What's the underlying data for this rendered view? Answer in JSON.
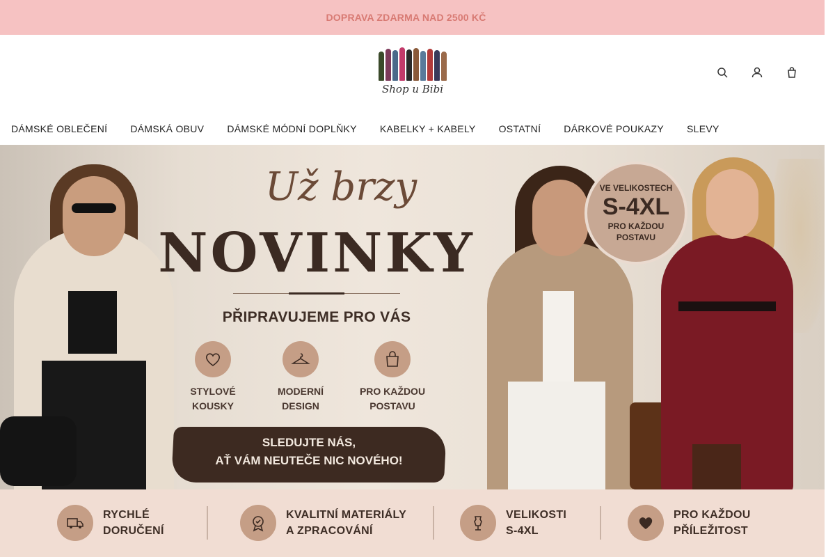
{
  "promo": {
    "text": "DOPRAVA ZDARMA NAD 2500 KČ",
    "glyph1": "",
    "glyph2": ""
  },
  "header": {
    "logo_text": "Shop u Bibi",
    "icons": [
      {
        "name": "search-icon",
        "glyph_a": "",
        "glyph_b": ""
      },
      {
        "name": "user-icon",
        "glyph_a": "",
        "glyph_b": ""
      },
      {
        "name": "cart-icon",
        "glyph_a": "",
        "glyph_b": ""
      }
    ]
  },
  "nav": {
    "items": [
      "DÁMSKÉ OBLEČENÍ",
      "DÁMSKÁ OBUV",
      "DÁMSKÉ MÓDNÍ DOPLŇKY",
      "KABELKY + KABELY",
      "OSTATNÍ",
      "DÁRKOVÉ POUKAZY",
      "SLEVY"
    ],
    "more_glyph": ""
  },
  "hero": {
    "script": "Už brzy",
    "title": "NOVINKY",
    "subtitle": "PŘIPRAVUJEME PRO VÁS",
    "features": [
      {
        "label": "STYLOVÉ\nKOUSKY",
        "icon": "heart-icon"
      },
      {
        "label": "MODERNÍ\nDESIGN",
        "icon": "hanger-icon"
      },
      {
        "label": "PRO KAŽDOU\nPOSTAVU",
        "icon": "shopping-bag-icon"
      }
    ],
    "banner_text": "SLEDUJTE NÁS,\nAŤ VÁM NEUTEČE NIC NOVÉHO!",
    "badge": {
      "top": "VE VELIKOSTECH",
      "big": "S-4XL",
      "bottom": "PRO KAŽDOU\nPOSTAVU"
    }
  },
  "benefits": [
    {
      "label": "RYCHLÉ\nDORUČENÍ",
      "icon": "truck-icon"
    },
    {
      "label": "KVALITNÍ MATERIÁLY\nA ZPRACOVÁNÍ",
      "icon": "quality-badge-icon"
    },
    {
      "label": "VELIKOSTI\nS-4XL",
      "icon": "dress-form-icon"
    },
    {
      "label": "PRO KAŽDOU\nPŘÍLEŽITOST",
      "icon": "heart-icon"
    }
  ],
  "colors": {
    "promo_bg": "#f6c2c2",
    "promo_text": "#d87a73",
    "accent_brown": "#3b2a22",
    "icon_circle": "#c59e86",
    "benefits_bg": "#f1ddd3"
  }
}
